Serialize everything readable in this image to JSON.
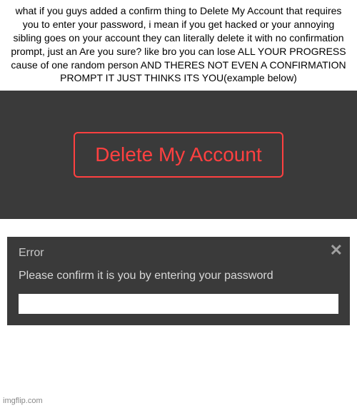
{
  "top_text": "what if you guys added a confirm thing to Delete My Account that requires you to enter your password, i mean if you get hacked or your annoying sibling goes on your account they can literally delete it with no confirmation prompt, just an Are you sure? like bro you can lose ALL YOUR PROGRESS cause of one random person AND THERES NOT EVEN A CONFIRMATION PROMPT IT JUST THINKS ITS YOU(example below)",
  "delete_button_label": "Delete My Account",
  "error_dialog": {
    "title": "Error",
    "message": "Please confirm it is you by entering your password",
    "close_symbol": "✕"
  },
  "watermark": "imgflip.com"
}
